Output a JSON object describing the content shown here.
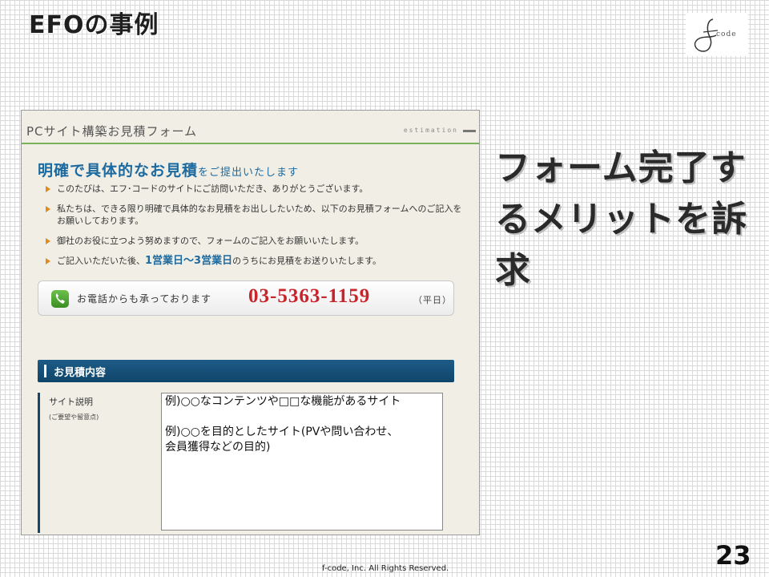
{
  "slide": {
    "title": "EFOの事例",
    "logo_text": "code",
    "callout": "フォーム完了するメリットを訴求",
    "page_number": "23",
    "copyright": "f-code, Inc. All Rights Reserved."
  },
  "form": {
    "header_title": "PCサイト構築お見積フォーム",
    "header_tag": "estimation",
    "headline_main": "明確で具体的なお見積",
    "headline_sub": "をご提出いたします",
    "bullets": [
      "このたびは、エフ･コードのサイトにご訪問いただき、ありがとうございます。",
      "私たちは、できる限り明確で具体的なお見積をお出ししたいため、以下のお見積フォームへのご記入をお願いしております。",
      "御社のお役に立つよう努めますので、フォームのご記入をお願いいたします。"
    ],
    "bullet4_pre": "ご記入いただいた後、",
    "bullet4_bold": "1営業日〜3営業日",
    "bullet4_post": "のうちにお見積をお送りいたします。",
    "phone_label": "お電話からも承っております",
    "phone_number": "03-5363-1159",
    "phone_note": "（平日）",
    "section_title": "お見積内容",
    "row_label": "サイト説明",
    "row_sub": "(ご要望や留意点)",
    "textarea_value": "例)○○なコンテンツや□□な機能があるサイト\n\n例)○○を目的としたサイト(PVや問い合わせ、\n会員獲得などの目的)"
  },
  "colors": {
    "accent_blue": "#1d6aa0",
    "phone_red": "#c8242b",
    "section_navy": "#0f4569",
    "header_green": "#7ab25a",
    "bullet_orange": "#e08a1e"
  }
}
